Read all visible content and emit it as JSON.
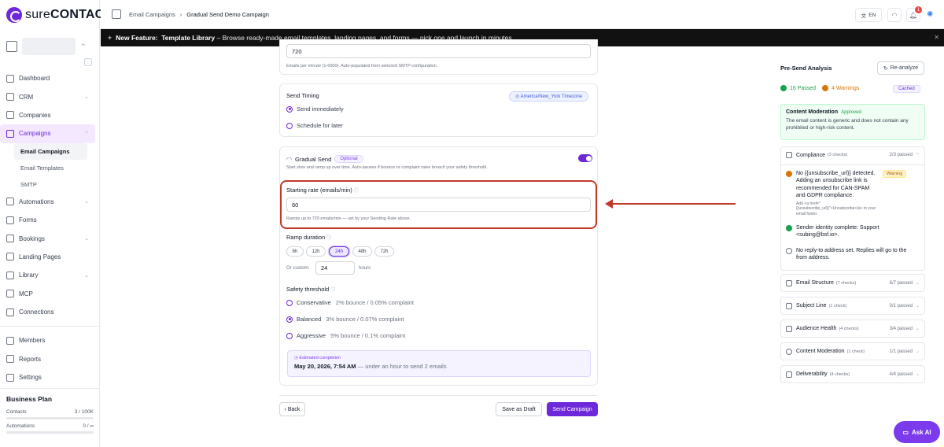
{
  "brand": {
    "pre": "sure",
    "post": "CONTACT"
  },
  "breadcrumb": {
    "parent": "Email Campaigns",
    "current": "Gradual Send Demo Campaign"
  },
  "topbar": {
    "lang": "EN",
    "notif_count": "1"
  },
  "banner": {
    "label": "New Feature:",
    "feature": "Template Library",
    "text": "– Browse ready-made email templates, landing pages, and forms — pick one and launch in minutes."
  },
  "nav": {
    "dashboard": "Dashboard",
    "crm": "CRM",
    "companies": "Companies",
    "campaigns": "Campaigns",
    "email_campaigns": "Email Campaigns",
    "email_templates": "Email Templates",
    "smtp": "SMTP",
    "automations": "Automations",
    "forms": "Forms",
    "bookings": "Bookings",
    "landing_pages": "Landing Pages",
    "library": "Library",
    "mcp": "MCP",
    "connections": "Connections",
    "members": "Members",
    "reports": "Reports",
    "settings": "Settings"
  },
  "plan": {
    "title": "Business Plan",
    "contacts_label": "Contacts",
    "contacts_val": "3 / 100K",
    "automations_label": "Automations",
    "automations_val": "0 / ∞"
  },
  "rate": {
    "value": "720",
    "hint": "Emails per minute (1-6000). Auto-populated from selected SMTP configuration."
  },
  "timing": {
    "title": "Send Timing",
    "timezone": "America/New_York Timezone",
    "opt1": "Send immediately",
    "opt2": "Schedule for later"
  },
  "gradual": {
    "title": "Gradual Send",
    "badge": "Optional",
    "desc": "Start slow and ramp up over time. Auto-pauses if bounce or complaint rates breach your safety threshold.",
    "start_label": "Starting rate (emails/min)",
    "start_value": "60",
    "start_hint": "Ramps up to 720 emails/min — set by your Sending Rate above.",
    "ramp_label": "Ramp duration",
    "ramp_opts": [
      "6h",
      "12h",
      "24h",
      "48h",
      "72h"
    ],
    "custom_label": "Or custom:",
    "custom_value": "24",
    "custom_unit": "hours",
    "safety_label": "Safety threshold",
    "safety": [
      {
        "name": "Conservative",
        "note": "2% bounce / 0.05% complaint"
      },
      {
        "name": "Balanced",
        "note": "3% bounce / 0.07% complaint"
      },
      {
        "name": "Aggressive",
        "note": "5% bounce / 0.1% complaint"
      }
    ],
    "est_label": "Estimated completion",
    "est_date": "May 20, 2026, 7:54 AM",
    "est_note": "— under an hour to send 2 emails"
  },
  "actions": {
    "back": "Back",
    "draft": "Save as Draft",
    "send": "Send Campaign"
  },
  "analysis": {
    "title": "Pre-Send Analysis",
    "reanalyze": "Re-analyze",
    "passed": "16 Passed",
    "warnings": "4 Warnings",
    "cached": "Cached",
    "moderation_title": "Content Moderation",
    "moderation_status": "Approved",
    "moderation_desc": "The email content is generic and does not contain any prohibited or high-risk content.",
    "compliance_title": "Compliance",
    "compliance_count": "(3 checks)",
    "compliance_pass": "2/3 passed",
    "c1": "No {{unsubscribe_url}} detected. Adding an unsubscribe link is recommended for CAN-SPAM and GDPR compliance.",
    "c1_tip": "Add <a href=\"{{unsubscribe_url}}\">Unsubscribe</a> to your email footer.",
    "warning": "Warning",
    "c2": "Sender identity complete: Support <subing@bsf.io>.",
    "c3": "No reply-to address set. Replies will go to the from address.",
    "sections": [
      {
        "name": "Email Structure",
        "count": "(7 checks)",
        "pass": "6/7 passed"
      },
      {
        "name": "Subject Line",
        "count": "(1 check)",
        "pass": "0/1 passed"
      },
      {
        "name": "Audience Health",
        "count": "(4 checks)",
        "pass": "3/4 passed"
      },
      {
        "name": "Content Moderation",
        "count": "(1 check)",
        "pass": "1/1 passed"
      },
      {
        "name": "Deliverability",
        "count": "(4 checks)",
        "pass": "4/4 passed"
      }
    ]
  },
  "ask_ai": "Ask AI"
}
